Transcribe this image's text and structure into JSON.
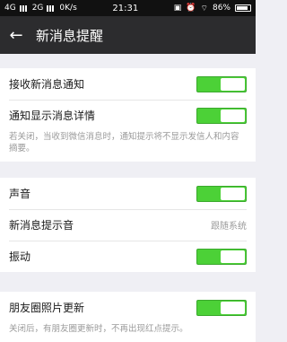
{
  "statusbar": {
    "network": "4G",
    "network2": "2G",
    "speed": "0K/s",
    "time": "21:31",
    "battery": "86%"
  },
  "header": {
    "title": "新消息提醒"
  },
  "sections": {
    "receive": {
      "label": "接收新消息通知",
      "enabled": true
    },
    "detail": {
      "label": "通知显示消息详情",
      "enabled": true,
      "hint": "若关闭，当收到微信消息时，通知提示将不显示发信人和内容摘要。"
    },
    "sound": {
      "label": "声音",
      "enabled": true
    },
    "tone": {
      "label": "新消息提示音",
      "value": "跟随系统"
    },
    "vibrate": {
      "label": "振动",
      "enabled": true
    },
    "moments": {
      "label": "朋友圈照片更新",
      "enabled": true,
      "hint": "关闭后，有朋友圈更新时，不再出现红点提示。"
    }
  },
  "colors": {
    "toggle_on": "#4cd137",
    "titlebar": "#2c2c2e"
  }
}
